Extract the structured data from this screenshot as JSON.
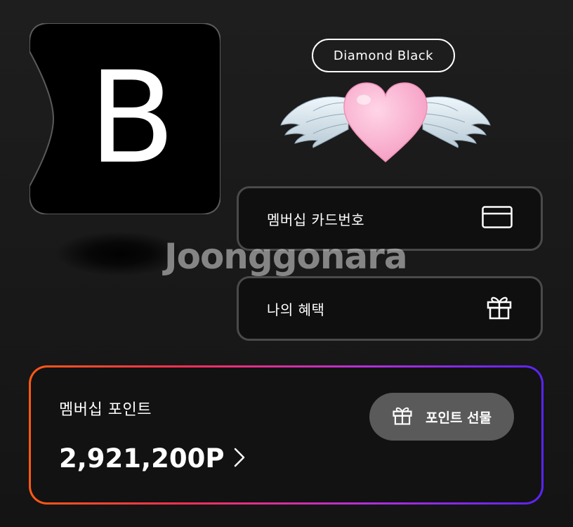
{
  "logo": {
    "letter": "B"
  },
  "membership": {
    "tier": "Diamond Black"
  },
  "menu": {
    "card_number_label": "멤버십 카드번호",
    "benefits_label": "나의 혜택"
  },
  "watermark": "Joonggonara",
  "points": {
    "title": "멤버십 포인트",
    "value": "2,921,200P",
    "gift_label": "포인트 선물"
  },
  "icons": {
    "card": "credit-card-icon",
    "gift": "gift-icon",
    "chevron": "chevron-right-icon",
    "heart": "winged-heart-icon"
  },
  "colors": {
    "background": "#1a1a1a",
    "gradient_start": "#ff5a12",
    "gradient_end": "#5a24f5",
    "button_gray": "#5a5a5a"
  }
}
